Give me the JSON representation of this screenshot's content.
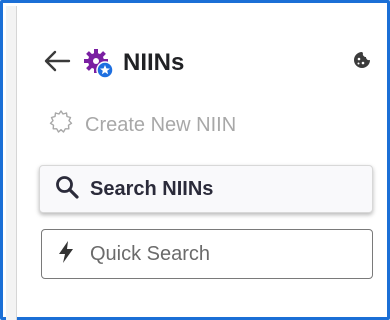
{
  "header": {
    "title": "NIINs"
  },
  "actions": {
    "create_label": "Create New NIIN",
    "search_label": "Search NIINs"
  },
  "quick_search": {
    "placeholder": "Quick Search",
    "value": ""
  },
  "icons": {
    "back": "arrow-left-icon",
    "title": "gears-icon",
    "create": "gear-outline-icon",
    "search": "magnifier-icon",
    "quick": "lightning-bolt-icon",
    "menu": "cookie-icon"
  },
  "colors": {
    "frame_border": "#1b6fd6",
    "gear_purple": "#7a1fa2",
    "gear_badge_blue": "#1e6fe0",
    "disabled_text": "#a8a8a8",
    "primary_text": "#202124"
  }
}
